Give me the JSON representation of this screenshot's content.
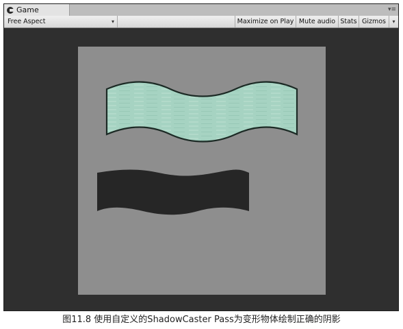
{
  "window": {
    "tab_title": "Game",
    "tab_icon": "unity-game-icon",
    "tab_menu_glyph": "▾≡"
  },
  "toolbar": {
    "aspect": "Free Aspect",
    "maximize_on_play": "Maximize on Play",
    "mute_audio": "Mute audio",
    "stats": "Stats",
    "gizmos": "Gizmos"
  },
  "scene": {
    "background_color": "#8e8e8e",
    "wave_color": "#a6d3c2",
    "shadow_color": "#262626"
  },
  "caption": "图11.8 使用自定义的ShadowCaster Pass为变形物体绘制正确的阴影"
}
